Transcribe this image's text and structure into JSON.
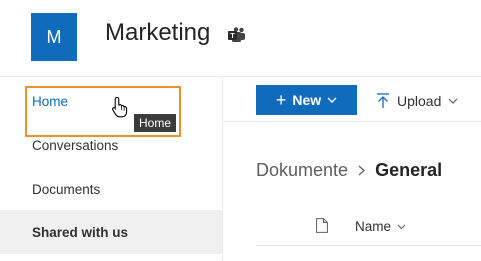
{
  "site": {
    "logo_letter": "M",
    "title": "Marketing",
    "icon": "teams-icon"
  },
  "sidebar": {
    "items": [
      {
        "label": "Home",
        "state": "hovered"
      },
      {
        "label": "Conversations"
      },
      {
        "label": "Documents"
      },
      {
        "label": "Shared with us",
        "state": "selected"
      }
    ],
    "tooltip": "Home"
  },
  "toolbar": {
    "new_label": "New",
    "upload_label": "Upload"
  },
  "breadcrumb": {
    "root": "Dokumente",
    "current": "General"
  },
  "list": {
    "columns": [
      {
        "label": "Name"
      }
    ]
  },
  "colors": {
    "accent": "#0f6cbd",
    "highlight": "#e8942b",
    "tooltip_bg": "#3b3b3b",
    "selected_bg": "#f0f0f0"
  }
}
